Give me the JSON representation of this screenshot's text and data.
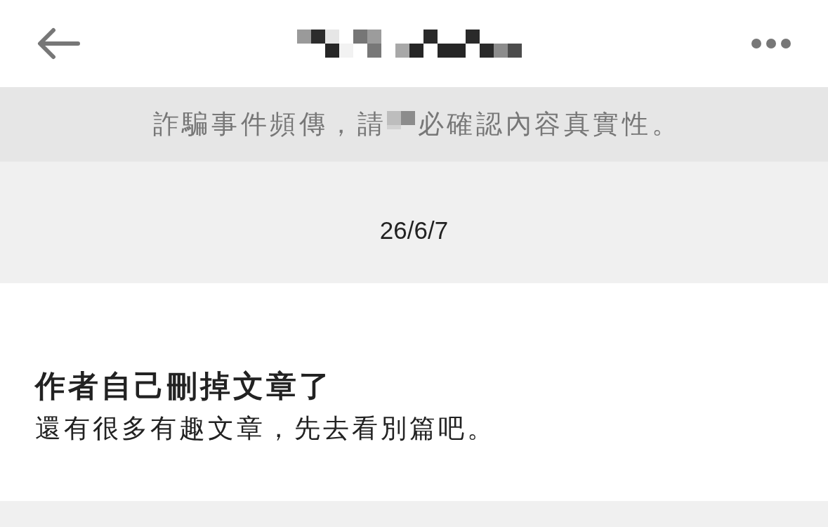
{
  "notice": {
    "text_before": "詐騙事件頻傳，請",
    "text_after": "必確認內容真實性。"
  },
  "date": "26/6/7",
  "message": {
    "title": "作者自己刪掉文章了",
    "body": "還有很多有趣文章，先去看別篇吧。"
  }
}
